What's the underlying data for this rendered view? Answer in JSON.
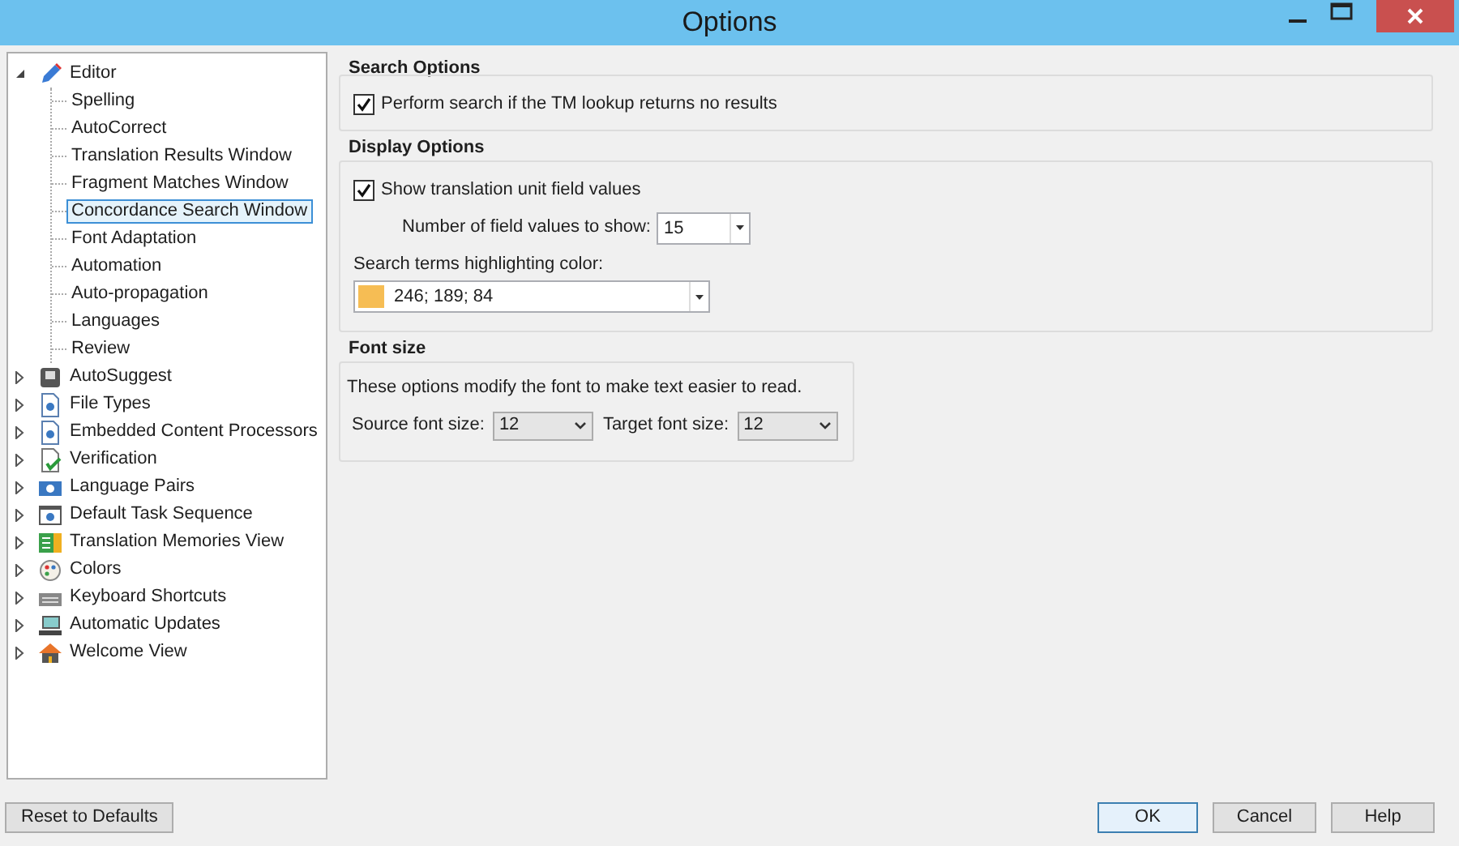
{
  "window": {
    "title": "Options"
  },
  "tree": [
    {
      "label": "Editor",
      "expanded": true,
      "children": [
        {
          "label": "Spelling",
          "selected": false
        },
        {
          "label": "AutoCorrect",
          "selected": false
        },
        {
          "label": "Translation Results Window",
          "selected": false
        },
        {
          "label": "Fragment Matches Window",
          "selected": false
        },
        {
          "label": "Concordance Search Window",
          "selected": true
        },
        {
          "label": "Font Adaptation",
          "selected": false
        },
        {
          "label": "Automation",
          "selected": false
        },
        {
          "label": "Auto-propagation",
          "selected": false
        },
        {
          "label": "Languages",
          "selected": false
        },
        {
          "label": "Review",
          "selected": false
        }
      ]
    },
    {
      "label": "AutoSuggest",
      "expanded": false
    },
    {
      "label": "File Types",
      "expanded": false
    },
    {
      "label": "Embedded Content Processors",
      "expanded": false
    },
    {
      "label": "Verification",
      "expanded": false
    },
    {
      "label": "Language Pairs",
      "expanded": false
    },
    {
      "label": "Default Task Sequence",
      "expanded": false
    },
    {
      "label": "Translation Memories View",
      "expanded": false
    },
    {
      "label": "Colors",
      "expanded": false
    },
    {
      "label": "Keyboard Shortcuts",
      "expanded": false
    },
    {
      "label": "Automatic Updates",
      "expanded": false
    },
    {
      "label": "Welcome View",
      "expanded": false
    }
  ],
  "search_options": {
    "title": "Search Options",
    "checkbox": {
      "label": "Perform search if the TM lookup returns no results",
      "checked": true
    }
  },
  "display_options": {
    "title": "Display Options",
    "checkbox": {
      "label": "Show translation unit field values",
      "checked": true
    },
    "field_count": {
      "label": "Number of field values to show:",
      "value": "15"
    },
    "highlight": {
      "label": "Search terms highlighting color:",
      "value": "246; 189; 84",
      "color": "#f6bd54"
    }
  },
  "font_size": {
    "title": "Font size",
    "description": "These options modify the font to make text easier to read.",
    "source": {
      "label": "Source font size:",
      "value": "12"
    },
    "target": {
      "label": "Target font size:",
      "value": "12"
    }
  },
  "buttons": {
    "reset": "Reset to Defaults",
    "ok": "OK",
    "cancel": "Cancel",
    "help": "Help"
  }
}
